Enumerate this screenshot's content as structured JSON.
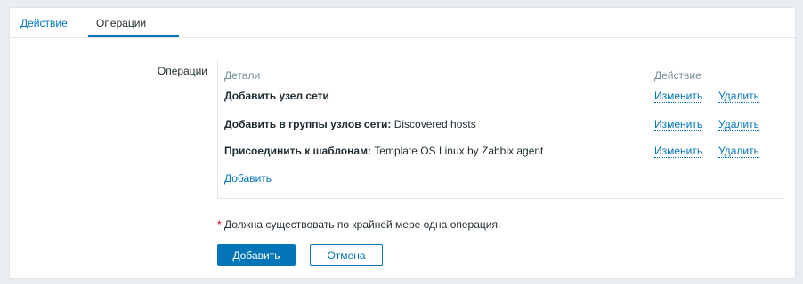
{
  "tabs": [
    {
      "label": "Действие"
    },
    {
      "label": "Операции"
    }
  ],
  "operations": {
    "label": "Операции",
    "header": {
      "details": "Детали",
      "action": "Действие"
    },
    "rows": [
      {
        "bold": "Добавить узел сети",
        "rest": "",
        "edit": "Изменить",
        "remove": "Удалить"
      },
      {
        "bold": "Добавить в группы узлов сети:",
        "rest": " Discovered hosts",
        "edit": "Изменить",
        "remove": "Удалить"
      },
      {
        "bold": "Присоединить к шаблонам:",
        "rest": " Template OS Linux by Zabbix agent",
        "edit": "Изменить",
        "remove": "Удалить"
      }
    ],
    "add_link": "Добавить"
  },
  "required_note": {
    "star": "*",
    "text": " Должна существовать по крайней мере одна операция."
  },
  "buttons": {
    "submit": "Добавить",
    "cancel": "Отмена"
  },
  "colors": {
    "accent": "#0275b8",
    "required": "#d40000"
  }
}
